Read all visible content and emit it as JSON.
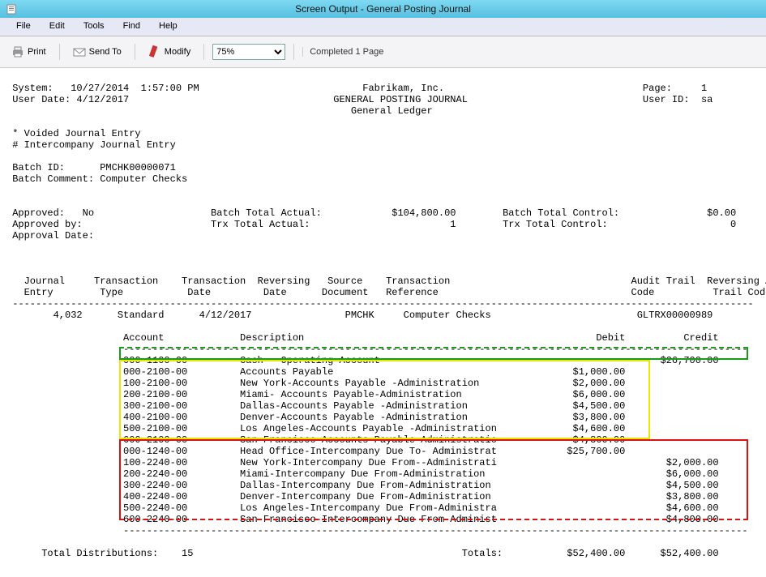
{
  "window": {
    "title": "Screen Output - General Posting Journal"
  },
  "menu": {
    "file": "File",
    "edit": "Edit",
    "tools": "Tools",
    "find": "Find",
    "help": "Help"
  },
  "toolbar": {
    "print": "Print",
    "sendto": "Send To",
    "modify": "Modify",
    "zoom": "75%",
    "status": "Completed 1 Page"
  },
  "header": {
    "system_label": "System:",
    "system": "10/27/2014  1:57:00 PM",
    "userdate_label": "User Date:",
    "userdate": "4/12/2017",
    "company": "Fabrikam, Inc.",
    "report_title": "GENERAL POSTING JOURNAL",
    "sub_title": "General Ledger",
    "page_label": "Page:",
    "page": "1",
    "userid_label": "User ID:",
    "userid": "sa",
    "note_void": "* Voided Journal Entry",
    "note_inter": "# Intercompany Journal Entry",
    "batchid_label": "Batch ID:",
    "batchid": "PMCHK00000071",
    "batchcomment_label": "Batch Comment:",
    "batchcomment": "Computer Checks",
    "approved_label": "Approved:",
    "approved": "No",
    "approvedby_label": "Approved by:",
    "approvaldate_label": "Approval Date:",
    "bta_label": "Batch Total Actual:",
    "bta": "$104,800.00",
    "tta_label": "Trx Total Actual:",
    "tta": "1",
    "btc_label": "Batch Total Control:",
    "btc": "$0.00",
    "ttc_label": "Trx Total Control:",
    "ttc": "0"
  },
  "colhdr": {
    "je": "Journal",
    "entry": "Entry",
    "tt": "Transaction",
    "type": "Type",
    "td": "Transaction",
    "date": "Date",
    "rv": "Reversing",
    "rvdate": "Date",
    "src": "Source",
    "doc": "Document",
    "tr": "Transaction",
    "ref": "Reference",
    "at": "Audit Trail",
    "atc": "Code",
    "ra": "Reversing Audit",
    "rtc": "Trail Code"
  },
  "trx": {
    "je": "4,032",
    "type": "Standard",
    "date": "4/12/2017",
    "src": "PMCHK",
    "ref": "Computer Checks",
    "audit": "GLTRX00000989"
  },
  "disthdr": {
    "acct": "Account",
    "desc": "Description",
    "debit": "Debit",
    "credit": "Credit"
  },
  "dist": [
    {
      "a": "000-1100-00",
      "d": "Cash - Operating Account",
      "dr": "",
      "cr": "$26,700.00"
    },
    {
      "a": "000-2100-00",
      "d": "Accounts Payable",
      "dr": "$1,000.00",
      "cr": ""
    },
    {
      "a": "100-2100-00",
      "d": "New York-Accounts Payable -Administration",
      "dr": "$2,000.00",
      "cr": ""
    },
    {
      "a": "200-2100-00",
      "d": "Miami- Accounts Payable-Administration",
      "dr": "$6,000.00",
      "cr": ""
    },
    {
      "a": "300-2100-00",
      "d": "Dallas-Accounts Payable -Administration",
      "dr": "$4,500.00",
      "cr": ""
    },
    {
      "a": "400-2100-00",
      "d": "Denver-Accounts Payable -Administration",
      "dr": "$3,800.00",
      "cr": ""
    },
    {
      "a": "500-2100-00",
      "d": "Los Angeles-Accounts Payable -Administration",
      "dr": "$4,600.00",
      "cr": ""
    },
    {
      "a": "600-2100-00",
      "d": "San Francisco-Accounts Payable-Administratio",
      "dr": "$4,800.00",
      "cr": ""
    },
    {
      "a": "000-1240-00",
      "d": "Head Office-Intercompany Due To- Administrat",
      "dr": "$25,700.00",
      "cr": ""
    },
    {
      "a": "100-2240-00",
      "d": "New York-Intercompany Due From--Administrati",
      "dr": "",
      "cr": "$2,000.00"
    },
    {
      "a": "200-2240-00",
      "d": "Miami-Intercompany Due From-Administration",
      "dr": "",
      "cr": "$6,000.00"
    },
    {
      "a": "300-2240-00",
      "d": "Dallas-Intercompany Due From-Administration",
      "dr": "",
      "cr": "$4,500.00"
    },
    {
      "a": "400-2240-00",
      "d": "Denver-Intercompany Due From-Administration",
      "dr": "",
      "cr": "$3,800.00"
    },
    {
      "a": "500-2240-00",
      "d": "Los Angeles-Intercompany Due From-Administra",
      "dr": "",
      "cr": "$4,600.00"
    },
    {
      "a": "600-2240-00",
      "d": "San Francisco-Intercompany Due From-Administ",
      "dr": "",
      "cr": "$4,800.00"
    }
  ],
  "totals": {
    "label": "Total Distributions:",
    "count": "15",
    "tlabel": "Totals:",
    "debit": "$52,400.00",
    "credit": "$52,400.00"
  }
}
